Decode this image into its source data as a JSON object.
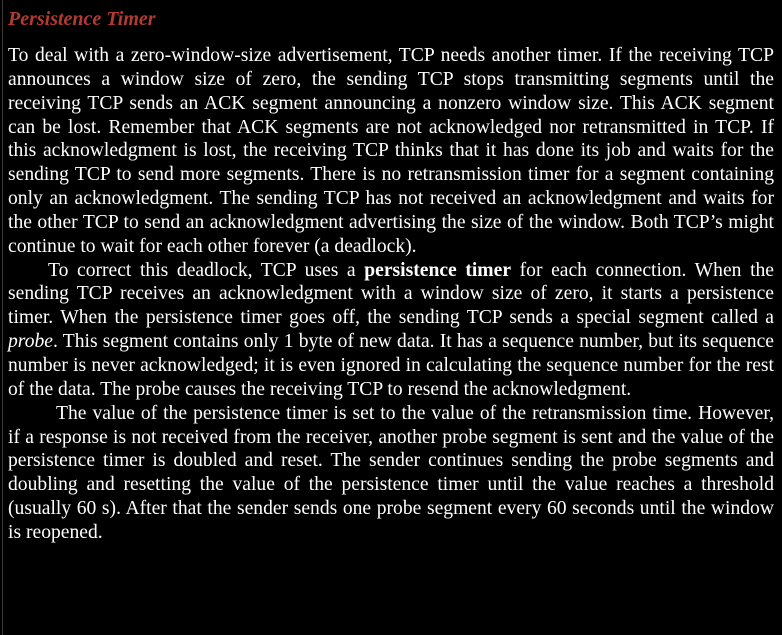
{
  "section": {
    "heading": "Persistence Timer"
  },
  "paragraphs": [
    {
      "text": "To deal with a zero-window-size advertisement, TCP needs another timer. If the receiving TCP announces a window size of zero, the sending TCP stops transmitting segments until the receiving TCP sends an ACK segment announcing a nonzero window size. This ACK segment can be lost. Remember that ACK segments are not acknowledged nor retransmitted in TCP. If this acknowledgment is lost, the receiving TCP thinks that it has done its job and waits for the sending TCP to send more segments. There is no retransmission timer for a segment containing only an acknowledgment. The sending TCP has not received an acknowledgment and waits for the other TCP to send an acknowledgment advertising the size of the window. Both TCP’s might continue to wait for each other forever (a deadlock)."
    },
    {
      "before_bold": "To correct this deadlock, TCP uses a ",
      "bold": "persistence timer",
      "after_bold": " for each connection. When the sending TCP receives an acknowledgment with a window size of zero, it starts a persistence timer. When the persistence timer goes off, the sending TCP sends a special segment called a ",
      "italic": "probe",
      "after_italic": ". This segment contains only 1 byte of new data. It has a sequence number, but its sequence number is never acknowledged; it is even ignored in calculating the sequence number for the rest of the data. The probe causes the receiving TCP to resend the acknowledgment."
    },
    {
      "text": "The value of the persistence timer is set to the value of the retransmission time. However, if a response is not received from the receiver, another probe segment is sent and the value of the persistence timer is doubled and reset. The sender continues sending the probe segments and doubling and resetting the value of the persistence timer until the value reaches a threshold (usually 60 s). After that the sender sends one probe segment every 60 seconds until the window is reopened."
    }
  ],
  "colors": {
    "background": "#000000",
    "text": "#ffffff",
    "heading": "#b23a33"
  }
}
